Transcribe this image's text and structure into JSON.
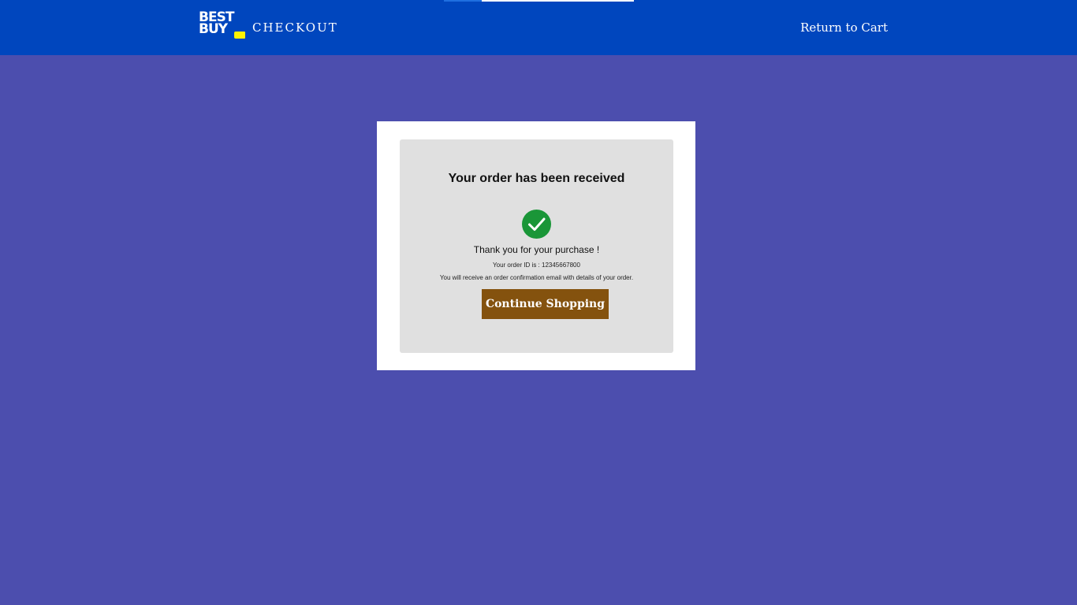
{
  "header": {
    "logo": {
      "line1": "BEST",
      "line2": "BUY"
    },
    "section_title": "CHECKOUT",
    "return_link": "Return to Cart"
  },
  "confirmation": {
    "title": "Your order has been received",
    "icon": "check-circle-icon",
    "thank_you": "Thank you for your purchase !",
    "order_id_text": "Your order ID is : 12345667800",
    "email_note": "You will receive an order confirmation email with details of your order.",
    "continue_button": "Continue Shopping"
  },
  "colors": {
    "header_bg": "#0046be",
    "page_bg": "#4c4eae",
    "check_green": "#1a9638",
    "button_bg": "#84520e",
    "logo_tag": "#fff200"
  }
}
